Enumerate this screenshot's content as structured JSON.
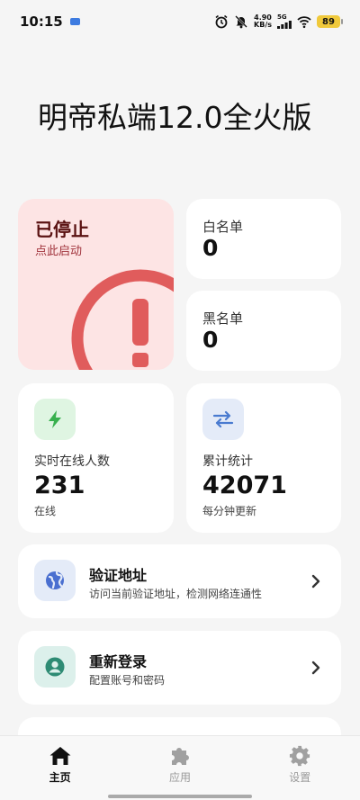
{
  "status_bar": {
    "time": "10:15",
    "net_speed_value": "4.90",
    "net_speed_unit": "KB/s",
    "signal_label": "5G",
    "battery": "89"
  },
  "app": {
    "title": "明帝私端12.0全火版"
  },
  "service": {
    "status": "已停止",
    "hint": "点此启动",
    "color": "#e05c5c"
  },
  "whitelist": {
    "label": "白名单",
    "count": "0"
  },
  "blacklist": {
    "label": "黑名单",
    "count": "0"
  },
  "online": {
    "label": "实时在线人数",
    "value": "231",
    "sub": "在线",
    "icon": "bolt-icon",
    "color": "#38b04e"
  },
  "total": {
    "label": "累计统计",
    "value": "42071",
    "sub": "每分钟更新",
    "icon": "swap-arrows-icon",
    "color": "#4a7bd0"
  },
  "actions": [
    {
      "title": "验证地址",
      "subtitle": "访问当前验证地址，检测网络连通性",
      "icon": "globe-icon"
    },
    {
      "title": "重新登录",
      "subtitle": "配置账号和密码",
      "icon": "user-icon"
    }
  ],
  "nav": {
    "items": [
      {
        "label": "主页",
        "icon": "home-icon",
        "active": true
      },
      {
        "label": "应用",
        "icon": "puzzle-icon",
        "active": false
      },
      {
        "label": "设置",
        "icon": "gear-icon",
        "active": false
      }
    ]
  }
}
